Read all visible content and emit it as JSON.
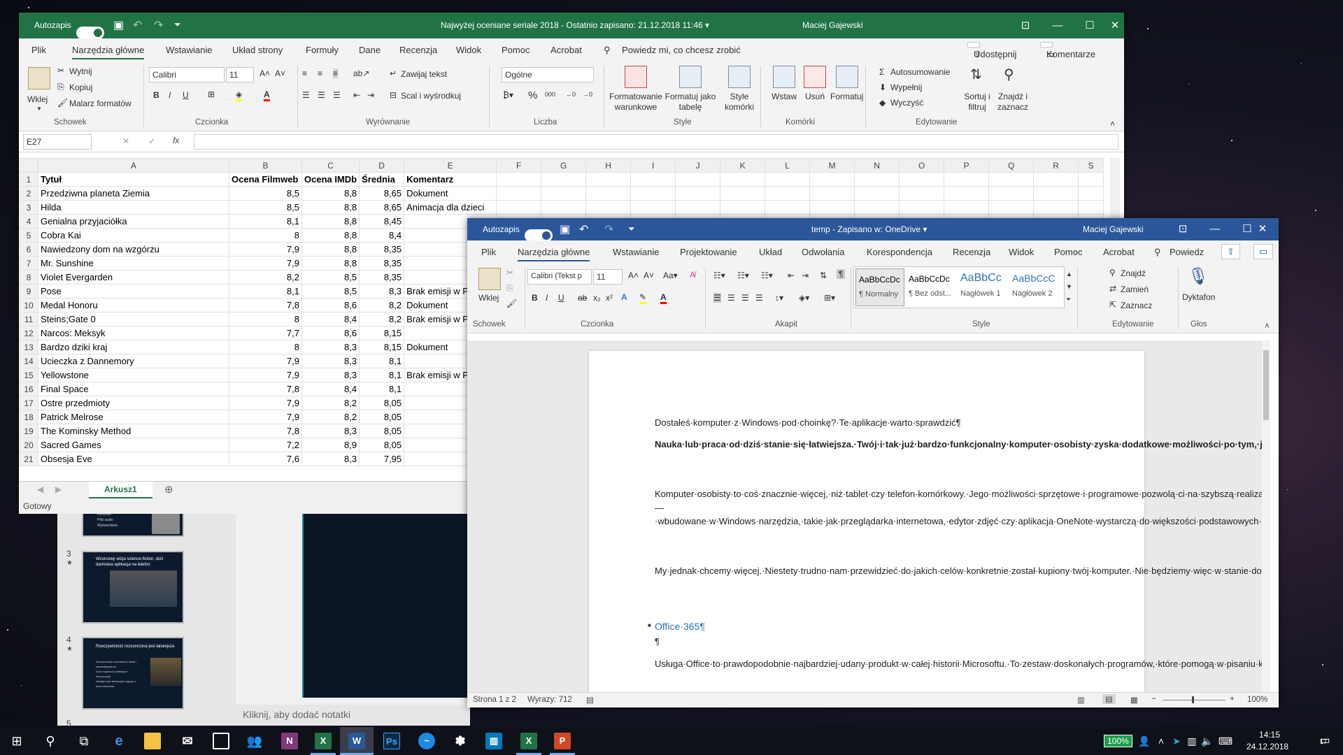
{
  "excel": {
    "autosave_label": "Autozapis",
    "title": "Najwyżej oceniane seriale 2018  -  Ostatnio zapisano: 21.12.2018 11:46  ▾",
    "user": "Maciej Gajewski",
    "menu": [
      "Plik",
      "Narzędzia główne",
      "Wstawianie",
      "Układ strony",
      "Formuły",
      "Dane",
      "Recenzja",
      "Widok",
      "Pomoc",
      "Acrobat"
    ],
    "tell_me": "Powiedz mi, co chcesz zrobić",
    "share": "Udostępnij",
    "comments": "Komentarze",
    "ribbon": {
      "paste": "Wklej",
      "cut": "Wytnij",
      "copy": "Kopiuj",
      "format_painter": "Malarz formatów",
      "group_clipboard": "Schowek",
      "font_name": "Calibri",
      "font_size": "11",
      "group_font": "Czcionka",
      "wrap_text": "Zawijaj tekst",
      "merge": "Scal i wyśrodkuj",
      "group_alignment": "Wyrównanie",
      "number_format": "Ogólne",
      "group_number": "Liczba",
      "cond_format": "Formatowanie warunkowe",
      "format_table": "Formatuj jako tabelę",
      "cell_styles": "Style komórki",
      "group_styles": "Style",
      "insert": "Wstaw",
      "delete": "Usuń",
      "format": "Formatuj",
      "group_cells": "Komórki",
      "autosum": "Autosumowanie",
      "fill": "Wypełnij",
      "clear": "Wyczyść",
      "sort": "Sortuj i filtruj",
      "find": "Znajdź i zaznacz",
      "group_editing": "Edytowanie"
    },
    "name_box": "E27",
    "columns": [
      "A",
      "B",
      "C",
      "D",
      "E",
      "F",
      "G",
      "H",
      "I",
      "J",
      "K",
      "L",
      "M",
      "N",
      "O",
      "P",
      "Q",
      "R",
      "S"
    ],
    "rows": [
      [
        "1",
        "Tytuł",
        "Ocena Filmweb",
        "Ocena IMDb",
        "Średnia",
        "Komentarz"
      ],
      [
        "2",
        "Przedziwna planeta Ziemia",
        "8,5",
        "8,8",
        "8,65",
        "Dokument"
      ],
      [
        "3",
        "Hilda",
        "8,5",
        "8,8",
        "8,65",
        "Animacja dla dzieci"
      ],
      [
        "4",
        "Genialna przyjaciółka",
        "8,1",
        "8,8",
        "8,45",
        ""
      ],
      [
        "5",
        "Cobra Kai",
        "8",
        "8,8",
        "8,4",
        ""
      ],
      [
        "6",
        "Nawiedzony dom na wzgórzu",
        "7,9",
        "8,8",
        "8,35",
        ""
      ],
      [
        "7",
        "Mr. Sunshine",
        "7,9",
        "8,8",
        "8,35",
        ""
      ],
      [
        "8",
        "Violet Evergarden",
        "8,2",
        "8,5",
        "8,35",
        ""
      ],
      [
        "9",
        "Pose",
        "8,1",
        "8,5",
        "8,3",
        "Brak emisji w P"
      ],
      [
        "10",
        "Medal Honoru",
        "7,8",
        "8,6",
        "8,2",
        "Dokument"
      ],
      [
        "11",
        "Steins;Gate 0",
        "8",
        "8,4",
        "8,2",
        "Brak emisji w P"
      ],
      [
        "12",
        "Narcos: Meksyk",
        "7,7",
        "8,6",
        "8,15",
        ""
      ],
      [
        "13",
        "Bardzo dziki kraj",
        "8",
        "8,3",
        "8,15",
        "Dokument"
      ],
      [
        "14",
        "Ucieczka z Dannemory",
        "7,9",
        "8,3",
        "8,1",
        ""
      ],
      [
        "15",
        "Yellowstone",
        "7,9",
        "8,3",
        "8,1",
        "Brak emisji w P"
      ],
      [
        "16",
        "Final Space",
        "7,8",
        "8,4",
        "8,1",
        ""
      ],
      [
        "17",
        "Ostre przedmioty",
        "7,9",
        "8,2",
        "8,05",
        ""
      ],
      [
        "18",
        "Patrick Melrose",
        "7,9",
        "8,2",
        "8,05",
        ""
      ],
      [
        "19",
        "The Kominsky Method",
        "7,8",
        "8,3",
        "8,05",
        ""
      ],
      [
        "20",
        "Sacred Games",
        "7,2",
        "8,9",
        "8,05",
        ""
      ],
      [
        "21",
        "Obsesja Eve",
        "7,6",
        "8,3",
        "7,95",
        ""
      ]
    ],
    "sheet_tab": "Arkusz1",
    "status": "Gotowy"
  },
  "ppt": {
    "slide_numbers": [
      "3",
      "4",
      "5"
    ],
    "slide3_title": "Wzorcowy wizja science-fiction, dziś darmowa aplikacja na telefon",
    "slide4_title": "Rzeczywistość rozszerzona jest łatwiejsza",
    "slide2_items": [
      "Kontroler",
      "Pliki audio",
      "Wyświetlanie"
    ],
    "slide4_items": [
      "Wzmacniamy mechanizm nauki i zapamiętywania",
      "Dużo szybsze publikacje i kompozycje",
      "Wydaje było atrakcyjne zajęcia z dziennikarstwa"
    ],
    "notes": "Kliknij, aby dodać notatki"
  },
  "word": {
    "autosave_label": "Autozapis",
    "title": "temp  -  Zapisano w: OneDrive  ▾",
    "user": "Maciej Gajewski",
    "menu": [
      "Plik",
      "Narzędzia główne",
      "Wstawianie",
      "Projektowanie",
      "Układ",
      "Odwołania",
      "Korespondencja",
      "Recenzja",
      "Widok",
      "Pomoc",
      "Acrobat"
    ],
    "tell_me": "Powiedz",
    "ribbon": {
      "paste": "Wklej",
      "group_clipboard": "Schowek",
      "font_name": "Calibri (Tekst p",
      "font_size": "11",
      "group_font": "Czcionka",
      "group_paragraph": "Akapit",
      "styles": [
        {
          "preview": "AaBbCcDc",
          "name": "¶ Normalny"
        },
        {
          "preview": "AaBbCcDc",
          "name": "¶ Bez odst..."
        },
        {
          "preview": "AaBbCc",
          "name": "Nagłówek 1"
        },
        {
          "preview": "AaBbCcC",
          "name": "Nagłówek 2"
        }
      ],
      "group_styles": "Style",
      "find": "Znajdź",
      "replace": "Zamień",
      "select": "Zaznacz",
      "group_editing": "Edytowanie",
      "dictate": "Dyktafon",
      "group_voice": "Głos"
    },
    "doc": {
      "p1": "Dostałeś·komputer·z·Windows·pod·choinkę?·Te·aplikacje·warto·sprawdzić¶",
      "p2": "Nauka·lub·praca·od·dziś·stanie·się·łatwiejsza.·Twój·i·tak·już·bardzo·funkcjonalny·komputer·osobisty·zyska·dodatkowe·możliwości·po·tym,·jak·zainstalujesz·na·nim·stosowne·programy.·Takie·jak·poniższe.¶",
      "p3": "Komputer·osobisty·to·coś·znacznie·więcej,·niż·tablet·czy·telefon·komórkowy.·Jego·możliwości·sprzętowe·i·programowe·pozwolą·ci·na·szybszą·realizację·nawet·najbardziej·skomplikowanych·zadań.·Znaczną·część·z·nich·będzie·można·realizować·bez·instalacji·czegokolwiek·—·wbudowane·w·Windows·narzędzia,·takie·jak·przeglądarka·internetowa,·edytor·zdjęć·czy·aplikacja·OneNote·wystarczą·do·większości·podstawowych·czynności.¶",
      "p4": "My·jednak·chcemy·więcej.·Niestety·trudno·nam·przewidzieć·do·jakich·celów·konkretnie·został·kupiony·twój·komputer.·Nie·będziemy·więc·w·stanie·dobrać·odpowiednich·narzędzi·do·studiów·inżynierskich,·pracy·nad·składaniem·publikacji·do·druku·czy·poligrafii.·Potrafimy·jednak·wskazać·te·narzędzia,·które·prawdopodobnie·przydadzą·się·wszystkim.·Takie,·jak·te·wskazane·niżej.¶",
      "h1": "Office·365¶",
      "pilcrow": "¶",
      "p5": "Usługa·Office·to·prawdopodobnie·najbardziej·udany·produkt·w·całej·historii·Microsoftu.·To·zestaw·doskonałych·programów,·które·pomogą·w·pisaniu·krótszych·bądź·dłuższych·tekstów,·w·przygotowywaniu·atrakcyjnych·prezentacji·do·pracy·lub·szkoły,·lub·też·do·zaawansowanej·pracy·na·liczbach·czy·bazach·danych."
    },
    "status_page": "Strona 1 z 2",
    "status_words": "Wyrazy: 712",
    "zoom": "100%"
  },
  "taskbar": {
    "battery": "100%",
    "time": "14:15",
    "date": "24.12.2018",
    "notifications": "17"
  }
}
